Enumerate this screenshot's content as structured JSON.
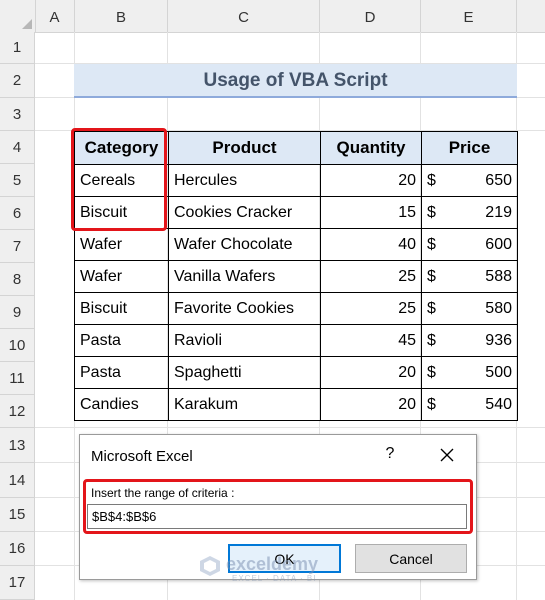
{
  "columns": [
    "A",
    "B",
    "C",
    "D",
    "E"
  ],
  "rows": [
    "1",
    "2",
    "3",
    "4",
    "5",
    "6",
    "7",
    "8",
    "9",
    "10",
    "11",
    "12",
    "13",
    "14",
    "15",
    "16",
    "17"
  ],
  "title": "Usage of VBA Script",
  "table": {
    "headers": [
      "Category",
      "Product",
      "Quantity",
      "Price"
    ],
    "currency_symbol": "$",
    "rows": [
      [
        "Cereals",
        "Hercules",
        "20",
        "650"
      ],
      [
        "Biscuit",
        "Cookies Cracker",
        "15",
        "219"
      ],
      [
        "Wafer",
        "Wafer Chocolate",
        "40",
        "600"
      ],
      [
        "Wafer",
        "Vanilla Wafers",
        "25",
        "588"
      ],
      [
        "Biscuit",
        "Favorite Cookies",
        "25",
        "580"
      ],
      [
        "Pasta",
        "Ravioli",
        "45",
        "936"
      ],
      [
        "Pasta",
        "Spaghetti",
        "20",
        "500"
      ],
      [
        "Candies",
        "Karakum",
        "20",
        "540"
      ]
    ]
  },
  "dialog": {
    "title": "Microsoft Excel",
    "help": "?",
    "prompt": "Insert the range of criteria :",
    "input_value": "$B$4:$B$6",
    "ok_label": "OK",
    "cancel_label": "Cancel"
  },
  "watermark": {
    "name": "exceldemy",
    "tagline": "EXCEL · DATA · BI"
  },
  "colors": {
    "highlight": "#e3151a",
    "header_fill": "#dde8f5",
    "title_text": "#44546a",
    "ok_border": "#0078d7"
  }
}
